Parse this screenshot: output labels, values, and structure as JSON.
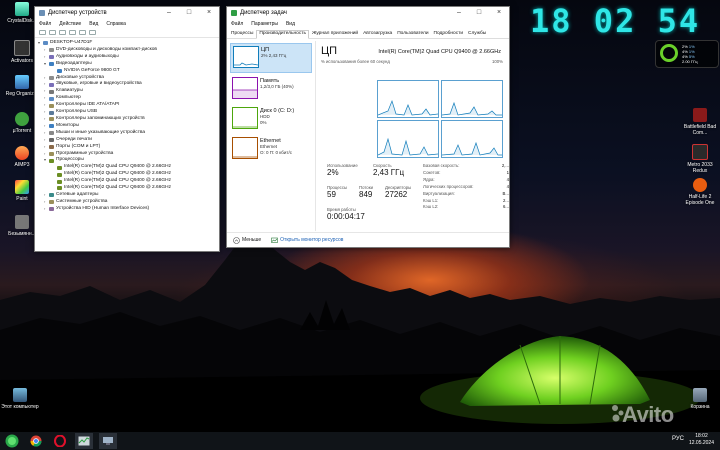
{
  "desktop": {
    "icons_left": [
      {
        "label": "CrystalDisk..."
      },
      {
        "label": "Activators"
      },
      {
        "label": "Reg Organizer"
      },
      {
        "label": "µTorrent"
      },
      {
        "label": "AIMP3"
      },
      {
        "label": "Paint"
      },
      {
        "label": "Безымянн..."
      }
    ],
    "icons_right": [
      {
        "label": "Battlefield Bad Com..."
      },
      {
        "label": "Metro 2033 Redux"
      },
      {
        "label": "Half-Life 2 Episode One"
      }
    ],
    "this_pc_label": "Этот компьютер",
    "recycle_label": "Корзина",
    "clock_widget": "18 02 54",
    "gauge": {
      "rows": [
        {
          "name": "2%",
          "val": "1%"
        },
        {
          "name": "4%",
          "val": "1%"
        },
        {
          "name": "4%",
          "val": "5%"
        },
        {
          "name": "2.00 ГГц",
          "val": ""
        }
      ],
      "cpu_fraction": 0.75
    },
    "watermark": "Avito"
  },
  "device_manager": {
    "title": "Диспетчер устройств",
    "menu": [
      "Файл",
      "Действие",
      "Вид",
      "Справка"
    ],
    "tree": [
      {
        "label": "DESKTOP-U47D1F",
        "level": 1,
        "arrow": "▾",
        "icon": "computer"
      },
      {
        "label": "DVD-дисководы и дисководы компакт-дисков",
        "level": 2,
        "arrow": "›",
        "icon": "disk"
      },
      {
        "label": "Аудиовходы и аудиовыходы",
        "level": 2,
        "arrow": "›",
        "icon": "audio"
      },
      {
        "label": "Видеоадаптеры",
        "level": 2,
        "arrow": "▾",
        "icon": "display"
      },
      {
        "label": "NVIDIA GeForce 9800 GT",
        "level": 3,
        "arrow": "",
        "icon": "display"
      },
      {
        "label": "Дисковые устройства",
        "level": 2,
        "arrow": "›",
        "icon": "disk"
      },
      {
        "label": "Звуковые, игровые и видеоустройства",
        "level": 2,
        "arrow": "›",
        "icon": "audio"
      },
      {
        "label": "Клавиатуры",
        "level": 2,
        "arrow": "›",
        "icon": "keyboard"
      },
      {
        "label": "Компьютер",
        "level": 2,
        "arrow": "›",
        "icon": "computer"
      },
      {
        "label": "Контроллеры IDE ATA/ATAPI",
        "level": 2,
        "arrow": "›",
        "icon": "ctrl"
      },
      {
        "label": "Контроллеры USB",
        "level": 2,
        "arrow": "›",
        "icon": "usb"
      },
      {
        "label": "Контроллеры запоминающих устройств",
        "level": 2,
        "arrow": "›",
        "icon": "ctrl"
      },
      {
        "label": "Мониторы",
        "level": 2,
        "arrow": "›",
        "icon": "display"
      },
      {
        "label": "Мыши и иные указывающие устройства",
        "level": 2,
        "arrow": "›",
        "icon": "mouse"
      },
      {
        "label": "Очереди печати",
        "level": 2,
        "arrow": "›",
        "icon": "printer"
      },
      {
        "label": "Порты (COM и LPT)",
        "level": 2,
        "arrow": "›",
        "icon": "port"
      },
      {
        "label": "Программные устройства",
        "level": 2,
        "arrow": "›",
        "icon": "ctrl"
      },
      {
        "label": "Процессоры",
        "level": 2,
        "arrow": "▾",
        "icon": "cpu"
      },
      {
        "label": "Intel(R) Core(TM)2 Quad CPU    Q9400  @ 2.66GHz",
        "level": 3,
        "arrow": "",
        "icon": "cpu"
      },
      {
        "label": "Intel(R) Core(TM)2 Quad CPU    Q9400  @ 2.66GHz",
        "level": 3,
        "arrow": "",
        "icon": "cpu"
      },
      {
        "label": "Intel(R) Core(TM)2 Quad CPU    Q9400  @ 2.66GHz",
        "level": 3,
        "arrow": "",
        "icon": "cpu"
      },
      {
        "label": "Intel(R) Core(TM)2 Quad CPU    Q9400  @ 2.66GHz",
        "level": 3,
        "arrow": "",
        "icon": "cpu"
      },
      {
        "label": "Сетевые адаптеры",
        "level": 2,
        "arrow": "›",
        "icon": "network"
      },
      {
        "label": "Системные устройства",
        "level": 2,
        "arrow": "›",
        "icon": "ctrl"
      },
      {
        "label": "Устройства HID (Human Interface Devices)",
        "level": 2,
        "arrow": "›",
        "icon": "hid"
      }
    ]
  },
  "task_manager": {
    "title": "Диспетчер задач",
    "menu": [
      "Файл",
      "Параметры",
      "Вид"
    ],
    "tabs": [
      "Процессы",
      "Производительность",
      "Журнал приложений",
      "Автозагрузка",
      "Пользователи",
      "Подробности",
      "Службы"
    ],
    "active_tab": 1,
    "perf_items": [
      {
        "name": "ЦП",
        "sub1": "2% 2,43 ГГц",
        "sub2": "",
        "color": "#117dbb"
      },
      {
        "name": "Память",
        "sub1": "1,2/3,0 ГБ (40%)",
        "sub2": "",
        "color": "#8b12ae"
      },
      {
        "name": "Диск 0 (C: D:)",
        "sub1": "HDD",
        "sub2": "0%",
        "color": "#4da60c"
      },
      {
        "name": "Ethernet",
        "sub1": "Ethernet",
        "sub2": "О: 0 П: 0 кбит/с",
        "color": "#a74f01"
      }
    ],
    "cpu_title": "ЦП",
    "cpu_model": "Intel(R) Core(TM)2 Quad CPU Q9400 @ 2.66GHz",
    "graph_caption": "% использования более 60 секунд",
    "graph_max": "100%",
    "usage_label": "Использование",
    "usage_value": "2%",
    "speed_label": "Скорость",
    "speed_value": "2,43 ГГц",
    "processes_label": "Процессы",
    "processes_value": "59",
    "threads_label": "Потоки",
    "threads_value": "849",
    "handles_label": "Дескрипторы",
    "handles_value": "27262",
    "uptime_label": "Время работы",
    "uptime_value": "0:00:04:17",
    "details": [
      {
        "k": "Базовая скорость:",
        "v": "2,..."
      },
      {
        "k": "Сокетов:",
        "v": "1"
      },
      {
        "k": "Ядра:",
        "v": "4"
      },
      {
        "k": "Логических процессоров:",
        "v": "4"
      },
      {
        "k": "Виртуализация:",
        "v": "В..."
      },
      {
        "k": "Кэш L1:",
        "v": "2..."
      },
      {
        "k": "Кэш L2:",
        "v": "6..."
      }
    ],
    "fewer_label": "Меньше",
    "monitor_link": "Открыть монитор ресурсов"
  },
  "taskbar": {
    "lang": "РУС",
    "time": "18:02",
    "date": "12.05.2024"
  }
}
